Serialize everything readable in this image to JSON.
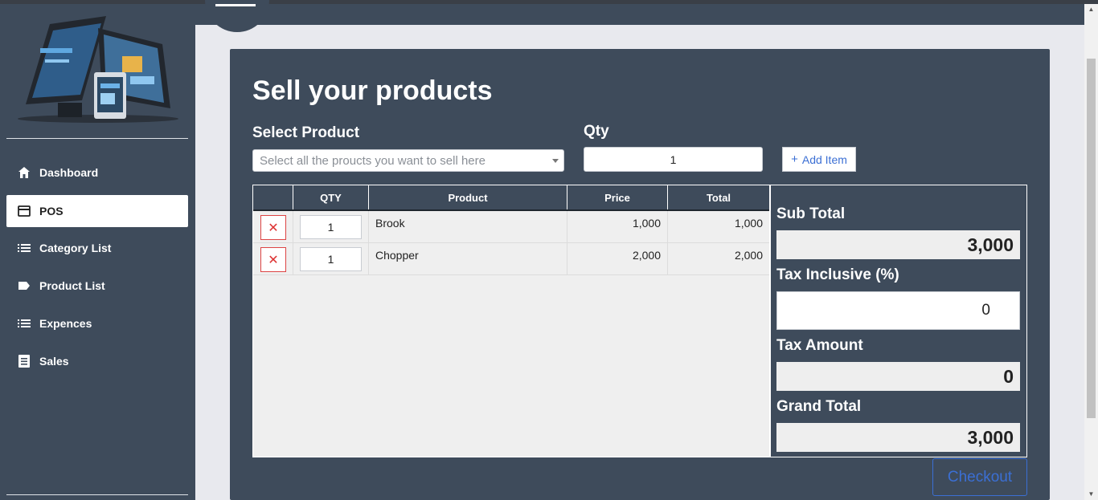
{
  "sidebar": {
    "items": [
      {
        "label": "Dashboard",
        "icon": "home-icon"
      },
      {
        "label": "POS",
        "icon": "card-icon",
        "active": true
      },
      {
        "label": "Category List",
        "icon": "list-icon"
      },
      {
        "label": "Product List",
        "icon": "tag-icon"
      },
      {
        "label": "Expences",
        "icon": "list-icon"
      },
      {
        "label": "Sales",
        "icon": "document-icon"
      }
    ]
  },
  "main": {
    "title": "Sell your products",
    "select_label": "Select Product",
    "select_placeholder": "Select all the proucts you want to sell here",
    "qty_label": "Qty",
    "qty_value": "1",
    "add_item_label": "Add Item"
  },
  "table": {
    "headers": [
      "",
      "QTY",
      "Product",
      "Price",
      "Total"
    ],
    "rows": [
      {
        "qty": "1",
        "product": "Brook",
        "price": "1,000",
        "total": "1,000"
      },
      {
        "qty": "1",
        "product": "Chopper",
        "price": "2,000",
        "total": "2,000"
      }
    ]
  },
  "summary": {
    "sub_total_label": "Sub Total",
    "sub_total": "3,000",
    "tax_label": "Tax Inclusive (%)",
    "tax_value": "0",
    "tax_amount_label": "Tax Amount",
    "tax_amount": "0",
    "grand_total_label": "Grand Total",
    "grand_total": "3,000"
  },
  "checkout_label": "Checkout",
  "colors": {
    "panel": "#3e4b5b",
    "accent": "#3b6fd4",
    "danger": "#dd4444"
  }
}
